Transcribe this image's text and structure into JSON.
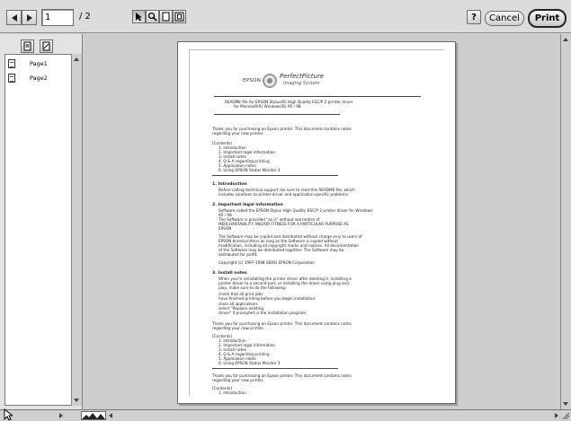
{
  "toolbar": {
    "page_number": "1",
    "page_total": "/ 2",
    "help_label": "?",
    "cancel_label": "Cancel",
    "print_label": "Print",
    "tools": [
      "arrow-tool-icon",
      "zoom-tool-icon",
      "page-view-icon",
      "fit-page-icon"
    ]
  },
  "sidebar": {
    "pages": [
      {
        "label": "Page1"
      },
      {
        "label": "Page2"
      }
    ]
  },
  "document": {
    "logo_brand": "EPSON",
    "logo_title": "PerfectPicture",
    "logo_subtitle": "Imaging System",
    "readme_line1": "README file for EPSON Stylus(R) High Quality ESC/P 2 printer driver",
    "readme_line2": "for Microsoft(R) Windows(R) 95 / 98",
    "thanks_line1": "Thank you for purchasing an Epson printer. This document contains notes",
    "thanks_line2": "regarding your new printer.",
    "contents_label": "[Contents]",
    "toc": [
      "1. Introduction",
      "2. Important legal information",
      "3. Install notes",
      "4. Q & A regarding printing",
      "5. Application notes",
      "6. Using EPSON Status Monitor 3"
    ],
    "intro_head": "1. Introduction",
    "intro_text": [
      "Before calling technical support, be sure to read this README file, which",
      "includes solutions to printer-driver and application-specific problems."
    ],
    "legal_head": "2. Important legal information",
    "legal_text": [
      "Software called the EPSON Stylus High Quality ESC/P 2 printer driver for Windows",
      "95 / 98",
      "The Software is provided \"as is\" without warranties of",
      "MERCHANTABILITY AND/OR FITNESS FOR A PARTICULAR PURPOSE AS",
      "EPSON",
      "",
      "The Software may be copied and distributed without charge only to users of",
      "EPSON brand printers as long as the Software is copied without",
      "modification, including all copyright marks and notices. All documentation",
      "of the Software may be distributed together. The Software may be",
      "distributed for profit.",
      "",
      "Copyright (c) 1997-1998 SEIKO EPSON Corporation"
    ],
    "install_head": "3. Install notes",
    "install_text": [
      "When you're reinstalling the printer driver after deleting it, installing a",
      "printer driver to a second port, or installing the driver using plug and",
      "play, make sure to do the following:",
      "                                           check that all print jobs",
      "  have finished printing before you begin installation.",
      "                                           close all applications",
      "                                           select \"Replace existing",
      "  driver\" if prompted in the installation program."
    ],
    "thanks2_line1": "Thank you for purchasing an Epson printer. This document contains notes",
    "thanks2_line2": "regarding your new printer.",
    "contents2_label": "[Contents]",
    "toc2": [
      "1. Introduction",
      "2. Important legal information",
      "3. Install notes",
      "4. Q & A regarding printing",
      "5. Application notes",
      "6. Using EPSON Status Monitor 3"
    ],
    "thanks3_line1": "Thank you for purchasing an Epson printer. This document contains notes",
    "thanks3_line2": "regarding your new printer.",
    "contents3_label": "[Contents]",
    "toc3_first": "1. Introduction"
  },
  "colors": {
    "toolbar_bg": "#dcdcdc",
    "preview_bg": "#cdcdcd",
    "page_bg": "#ffffff"
  }
}
